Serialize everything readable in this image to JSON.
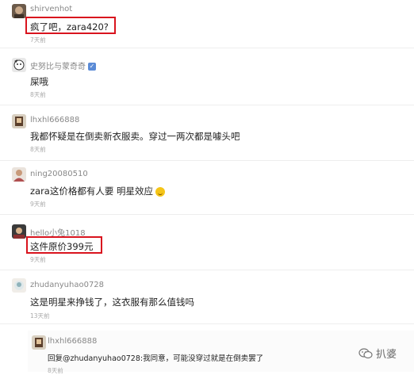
{
  "comments": [
    {
      "username": "shirvenhot",
      "text": "疯了吧，zara420?",
      "time": "7天前"
    },
    {
      "username": "史努比与蒙奇奇",
      "text": "屎哦",
      "time": "8天前"
    },
    {
      "username": "lhxhl666888",
      "text": "我都怀疑是在倒卖新衣服卖。穿过一两次都是噱头吧",
      "time": "8天前"
    },
    {
      "username": "ning20080510",
      "text": "zara这价格都有人要 明星效应",
      "time": "9天前"
    },
    {
      "username": "hello小兔1018",
      "text": "这件原价399元",
      "time": "9天前"
    },
    {
      "username": "zhudanyuhao0728",
      "text": "这是明星来挣钱了，这衣服有那么值钱吗",
      "time": "13天前"
    }
  ],
  "reply": {
    "username": "lhxhl666888",
    "text": "回复@zhudanyuhao0728:我同意，可能没穿过就是在倒卖罢了",
    "time": "8天前"
  },
  "watermark": {
    "text": "扒婆",
    "icon": "wechat-icon"
  },
  "colors": {
    "highlight": "#d9141e",
    "username": "#888888",
    "text": "#222222",
    "time": "#aaaaaa"
  }
}
